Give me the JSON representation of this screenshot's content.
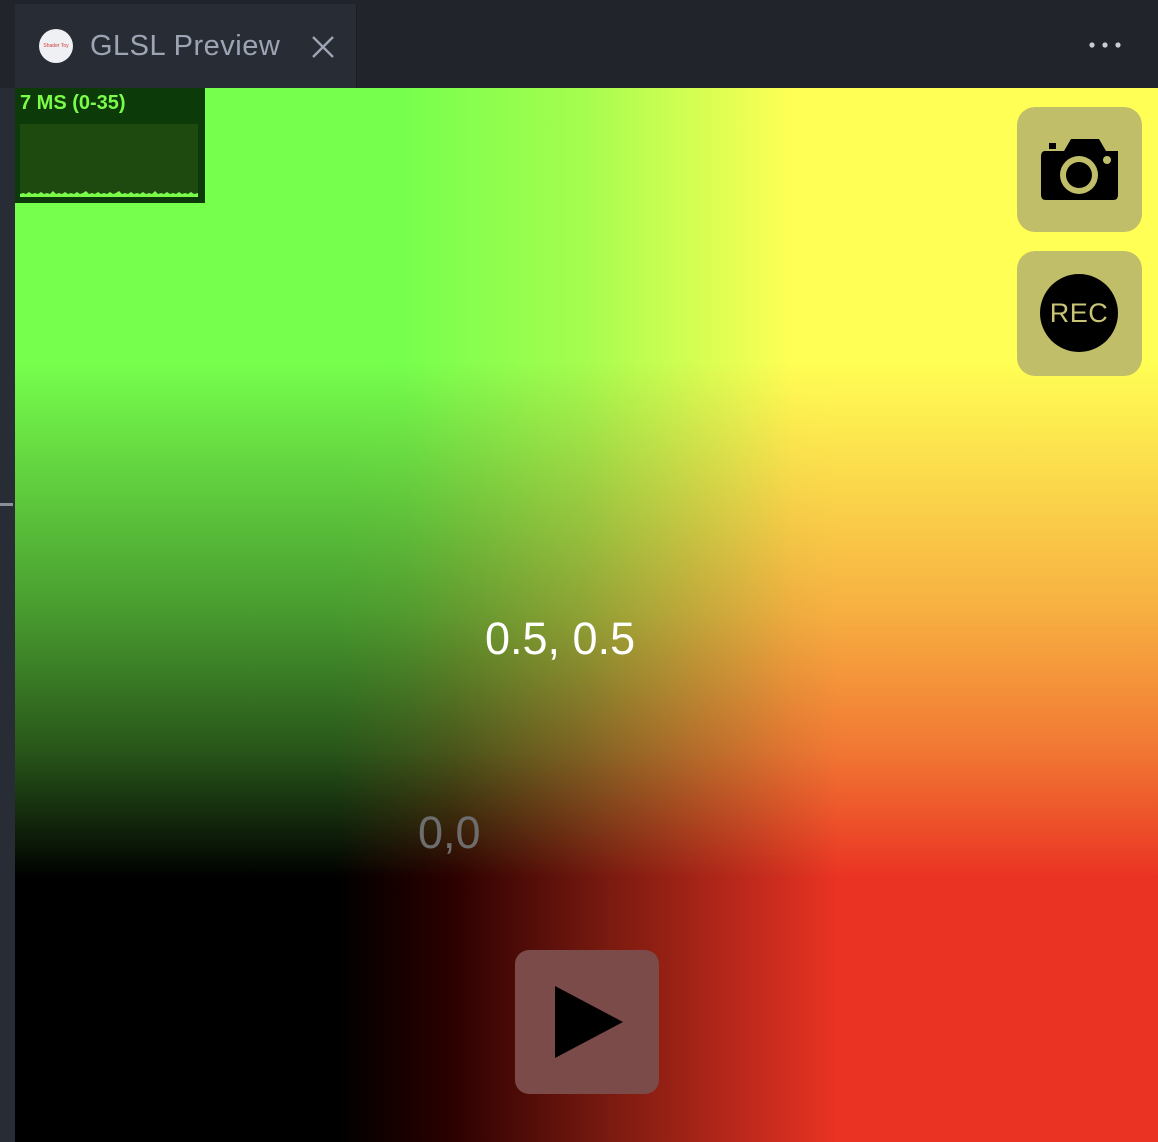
{
  "tab": {
    "icon_text": "Shader Toy",
    "title": "GLSL Preview",
    "close_icon": "close-icon"
  },
  "toolbar": {
    "more_icon": "ellipsis-icon"
  },
  "preview": {
    "stats_label": "7 MS (0-35)",
    "center_coord": "0.5, 0.5",
    "origin_coord": "0,0",
    "rec_label": "REC",
    "screenshot_icon": "camera-icon",
    "play_icon": "play-icon"
  },
  "colors": {
    "editor_bg": "#282c34",
    "tabbar_bg": "#21252b",
    "tab_text": "#9da5b4",
    "stats_text": "#7cfc4a",
    "button_bg": "#c1be6a"
  }
}
